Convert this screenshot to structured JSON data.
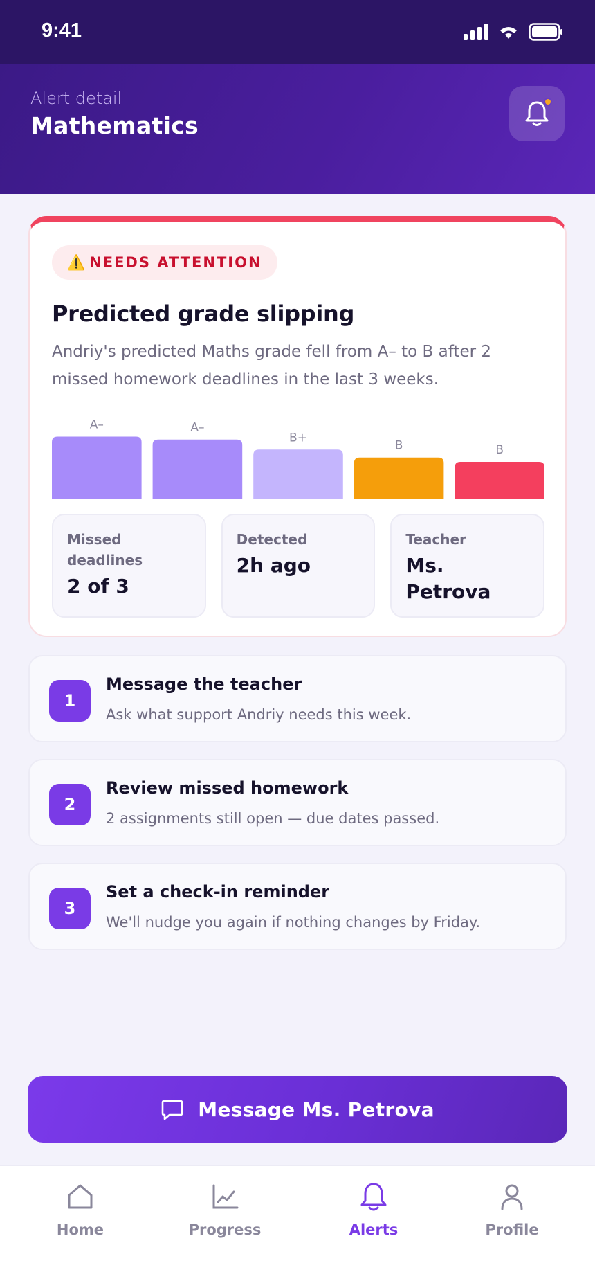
{
  "status_bar": {
    "time": "9:41"
  },
  "header": {
    "subtitle": "Alert detail",
    "title": "Mathematics"
  },
  "alert": {
    "badge": "NEEDS ATTENTION",
    "badge_icon": "warning-icon",
    "title": "Predicted grade slipping",
    "description": "Andriy's predicted Maths grade fell from A– to B after 2 missed homework deadlines in the last 3 weeks.",
    "trend": [
      {
        "grade": "A–",
        "level": 0.86,
        "color": "#a78bfa"
      },
      {
        "grade": "A–",
        "level": 0.82,
        "color": "#a78bfa"
      },
      {
        "grade": "B+",
        "level": 0.68,
        "color": "#c4b5fd"
      },
      {
        "grade": "B",
        "level": 0.57,
        "color": "#f59e0b"
      },
      {
        "grade": "B",
        "level": 0.51,
        "color": "#f43f5e"
      }
    ],
    "stats": [
      {
        "label": "Missed deadlines",
        "value": "2 of 3"
      },
      {
        "label": "Detected",
        "value": "2h ago"
      },
      {
        "label": "Teacher",
        "value": "Ms. Petrova"
      }
    ]
  },
  "steps": [
    {
      "num": "1",
      "title": "Message the teacher",
      "desc": "Ask what support Andriy needs this week."
    },
    {
      "num": "2",
      "title": "Review missed homework",
      "desc": "2 assignments still open — due dates passed."
    },
    {
      "num": "3",
      "title": "Set a check-in reminder",
      "desc": "We'll nudge you again if nothing changes by Friday."
    }
  ],
  "cta": {
    "label": "Message Ms. Petrova",
    "icon": "chat-icon"
  },
  "tabs": [
    {
      "label": "Home",
      "icon": "home-icon",
      "active": false
    },
    {
      "label": "Progress",
      "icon": "chart-icon",
      "active": false
    },
    {
      "label": "Alerts",
      "icon": "bell-icon",
      "active": true
    },
    {
      "label": "Profile",
      "icon": "user-icon",
      "active": false
    }
  ],
  "colors": {
    "primary": "#7a3be6",
    "alert": "#f0445f",
    "header": "#3b1a86"
  }
}
